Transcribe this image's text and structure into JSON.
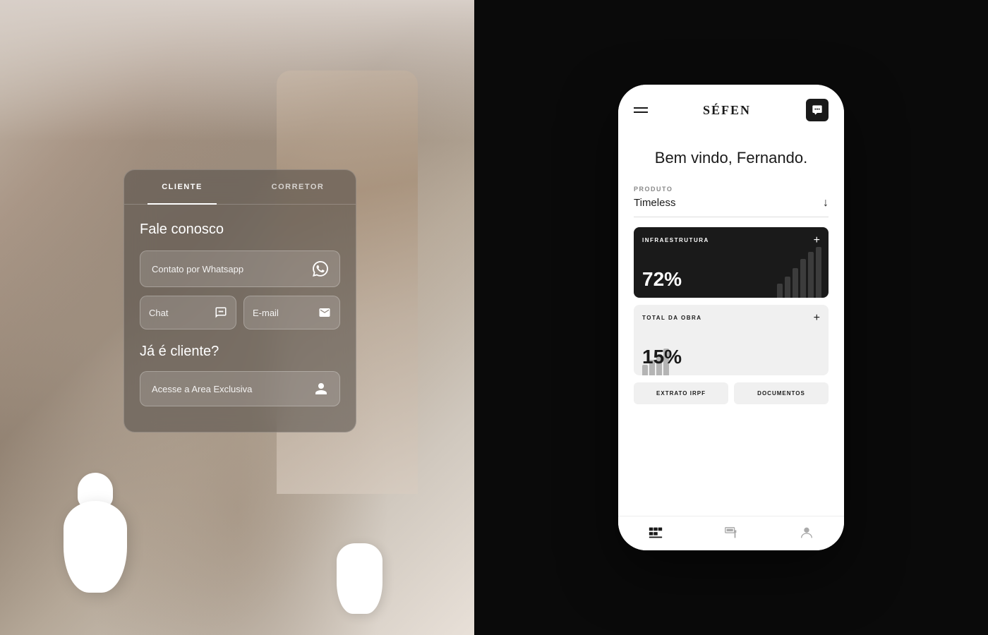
{
  "left": {
    "card": {
      "tabs": [
        {
          "id": "cliente",
          "label": "CLIENTE",
          "active": true
        },
        {
          "id": "corretor",
          "label": "CORRETOR",
          "active": false
        }
      ],
      "section1_title": "Fale conosco",
      "whatsapp_btn": "Contato por Whatsapp",
      "chat_btn": "Chat",
      "email_btn": "E-mail",
      "section2_title": "Já é cliente?",
      "exclusive_btn": "Acesse a Area Exclusiva"
    }
  },
  "right": {
    "phone": {
      "brand": "SÉFEN",
      "welcome": "Bem vindo, Fernando.",
      "product_label": "PRODUTO",
      "product_value": "Timeless",
      "infra_card": {
        "title": "INFRAESTRUTURA",
        "value": "72%"
      },
      "obra_card": {
        "title": "TOTAL DA OBRA",
        "value": "15%"
      },
      "btn_extrato": "EXTRATO IRPF",
      "btn_documentos": "DOCUMENTOS"
    }
  }
}
